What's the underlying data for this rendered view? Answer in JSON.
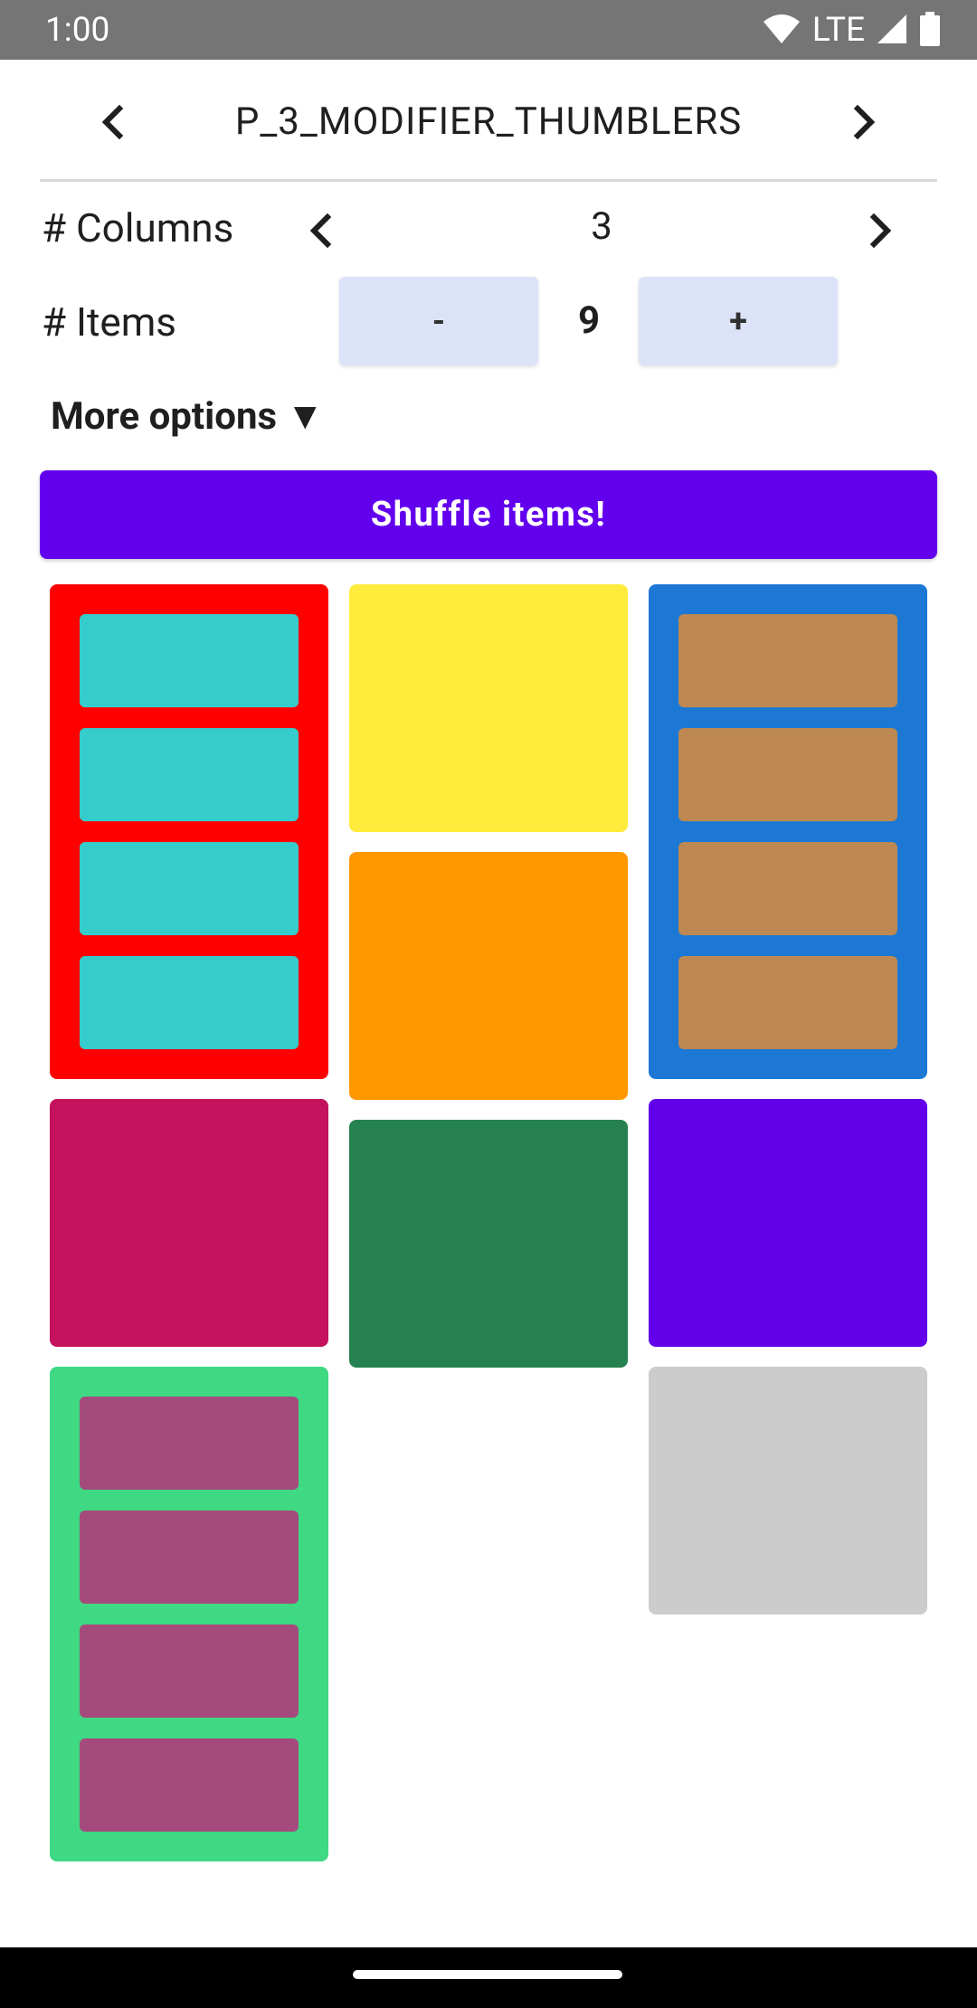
{
  "status_bar": {
    "time": "1:00",
    "network": "LTE",
    "icons": [
      "wifi-icon",
      "lte-label",
      "signal-icon",
      "battery-icon"
    ]
  },
  "nav": {
    "title": "P_3_MODIFIER_THUMBLERS",
    "prev_icon": "chevron-left-icon",
    "next_icon": "chevron-right-icon"
  },
  "controls": {
    "columns_label": "# Columns",
    "columns_value": "3",
    "items_label": "# Items",
    "items_value": "9",
    "minus_label": "-",
    "plus_label": "+",
    "more_options_label": "More options ▼",
    "shuffle_label": "Shuffle items!"
  },
  "grid": {
    "columns": 3,
    "items": [
      {
        "color": "#ff0000",
        "inner_color": "#36cccc",
        "inner_count": 4
      },
      {
        "color": "#ffeb3b",
        "inner_count": 0
      },
      {
        "color": "#1c78d4",
        "inner_color": "#bd8852",
        "inner_count": 4
      },
      {
        "color": "#ff9700",
        "inner_count": 0
      },
      {
        "color": "#c4125d",
        "inner_count": 0
      },
      {
        "color": "#6200ea",
        "inner_count": 0
      },
      {
        "color": "#258250",
        "inner_count": 0
      },
      {
        "color": "#3ed982",
        "inner_color": "#a54a7c",
        "inner_count": 4
      },
      {
        "color": "#cccccc",
        "inner_count": 0
      }
    ]
  }
}
